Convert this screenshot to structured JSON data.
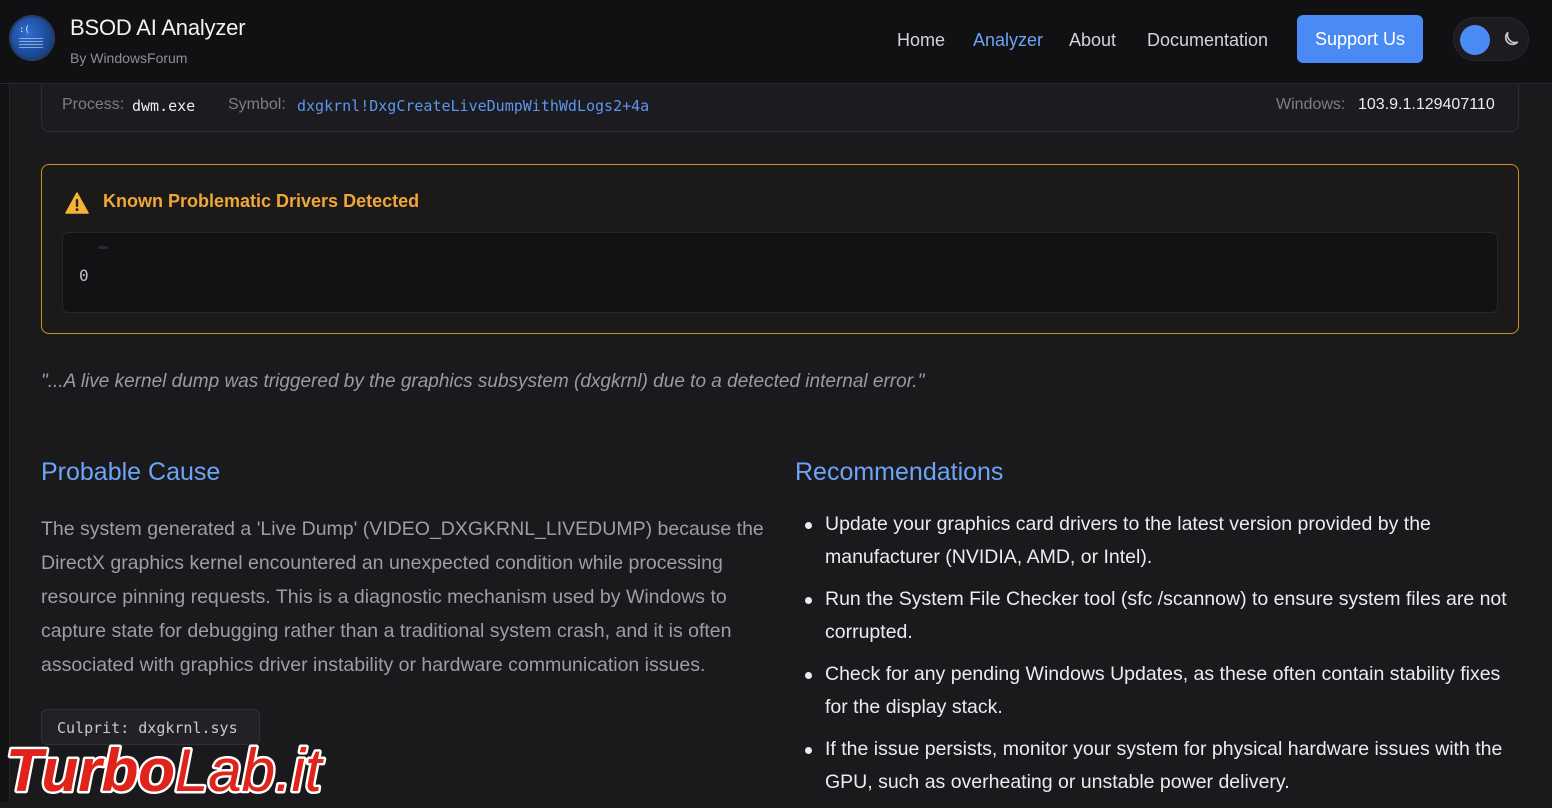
{
  "header": {
    "title": "BSOD AI Analyzer",
    "subtitle": "By WindowsForum",
    "logo_face": ":(",
    "nav": {
      "home": "Home",
      "analyzer": "Analyzer",
      "about": "About",
      "documentation": "Documentation"
    },
    "support_label": "Support Us",
    "theme_toggle_icon": "moon-icon"
  },
  "crash_info": {
    "process_label": "Process:",
    "process_value": "dwm.exe",
    "symbol_label": "Symbol:",
    "symbol_value": "dxgkrnl!DxgCreateLiveDumpWithWdLogs2+4a",
    "windows_label": "Windows:",
    "windows_value": "103.9.1.129407110"
  },
  "drivers_alert": {
    "icon": "warning-icon",
    "title": "Known Problematic Drivers Detected",
    "value": "0"
  },
  "quote": "\"...A live kernel dump was triggered by the graphics subsystem (dxgkrnl) due to a detected internal error.\"",
  "probable_cause": {
    "title": "Probable Cause",
    "text": "The system generated a 'Live Dump' (VIDEO_DXGKRNL_LIVEDUMP) because the DirectX graphics kernel encountered an unexpected condition while processing resource pinning requests. This is a diagnostic mechanism used by Windows to capture state for debugging rather than a traditional system crash, and it is often associated with graphics driver instability or hardware communication issues.",
    "culprit": "Culprit: dxgkrnl.sys"
  },
  "recommendations": {
    "title": "Recommendations",
    "items": [
      "Update your graphics card drivers to the latest version provided by the manufacturer (NVIDIA, AMD, or Intel).",
      "Run the System File Checker tool (sfc /scannow) to ensure system files are not corrupted.",
      "Check for any pending Windows Updates, as these often contain stability fixes for the display stack.",
      "If the issue persists, monitor your system for physical hardware issues with the GPU, such as overheating or unstable power delivery."
    ]
  },
  "watermark": {
    "text": "TurboLab.it"
  },
  "colors": {
    "accent": "#4a8af4",
    "link": "#6ea4f7",
    "warning": "#f0a73a",
    "warning_border": "#c9931e",
    "watermark": "#e0241b"
  }
}
